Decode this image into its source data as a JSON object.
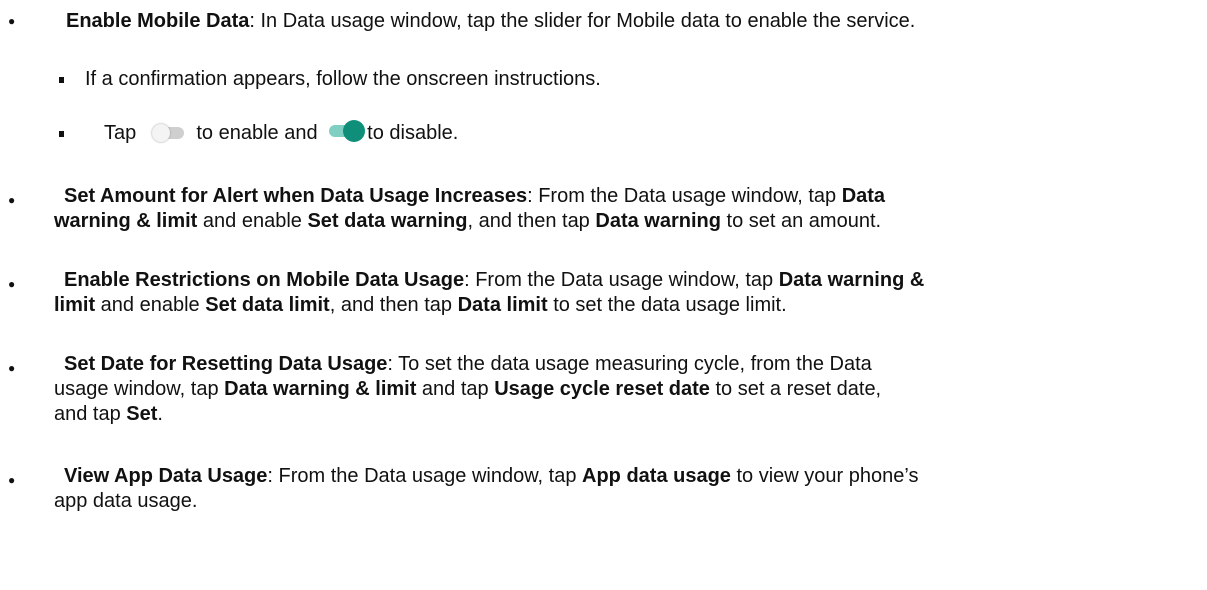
{
  "items": [
    {
      "title": "Enable Mobile Data",
      "text": ": In Data usage window, tap the slider for Mobile data to enable the service.",
      "sub": [
        "If a confirmation appears, follow the onscreen instructions.",
        {
          "a": "Tap",
          "b": "to enable and",
          "c": "to disable."
        }
      ]
    },
    {
      "title": "Set Amount for Alert when Data Usage Increases",
      "p1": ": From the Data usage window, tap ",
      "b1": "Data",
      "b1b": "warning  & limit",
      "p2": " and enable ",
      "b2": "Set data warning",
      "p3": ", and then tap ",
      "b3": "Data warning",
      "p4": " to set an amount."
    },
    {
      "title": "Enable Restrictions on Mobile Data Usage",
      "p1": ": From the Data usage window, tap ",
      "b1": "Data warning &",
      "b1b": "limit",
      "p2": "  and enable ",
      "b2": "Set data limit",
      "p3": ", and then tap ",
      "b3": "Data limit",
      "p4": " to set the data usage limit."
    },
    {
      "title": "Set Date for Resetting Data Usage",
      "p1": ": To set the data usage measuring cycle, from the Data",
      "p1b": "usage  window, tap ",
      "b1": "Data warning & limit",
      "p2": " and tap ",
      "b2": "Usage cycle reset date",
      "p3": " to set a reset date,",
      "p3b": "and tap ",
      "b3": "Set",
      "p4": "."
    },
    {
      "title": "View App Data Usage",
      "p1": ": From the Data usage window, tap ",
      "b1": "App data usage",
      "p2": " to view your phone’s",
      "p2b": "app data usage."
    }
  ]
}
